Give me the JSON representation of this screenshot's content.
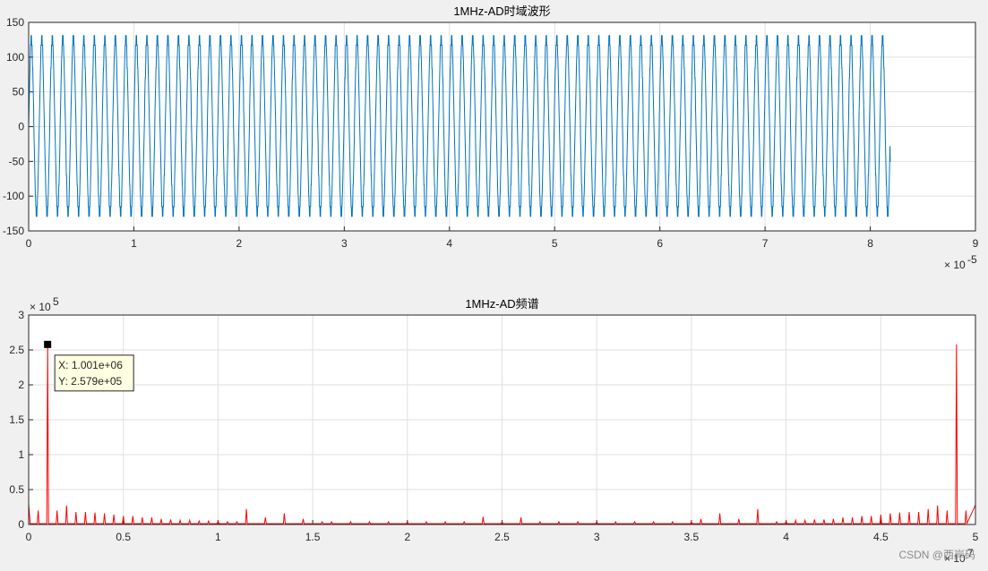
{
  "watermark": "CSDN @西岸码",
  "chart_data": [
    {
      "type": "line",
      "title": "1MHz-AD时域波形",
      "xlabel": "",
      "ylabel": "",
      "xlim": [
        0,
        9
      ],
      "ylim": [
        -150,
        150
      ],
      "x_exponent_label": "× 10",
      "x_exponent": "-5",
      "x_ticks": [
        "0",
        "1",
        "2",
        "3",
        "4",
        "5",
        "6",
        "7",
        "8",
        "9"
      ],
      "y_ticks": [
        "-150",
        "-100",
        "-50",
        "0",
        "50",
        "100",
        "150"
      ],
      "grid": true,
      "line_color": "#0072bd",
      "series": [
        {
          "signal_description": "sinusoid ~1 MHz, amplitude ≈ 122, sampled with visible quantization steps",
          "frequency_per_unit": 10.01,
          "amplitude": 122,
          "x_start": 0,
          "x_end": 8.19,
          "end_value": -50
        }
      ]
    },
    {
      "type": "line",
      "title": "1MHz-AD频谱",
      "xlabel": "",
      "ylabel": "",
      "xlim": [
        0,
        5
      ],
      "ylim": [
        0,
        3
      ],
      "x_exponent_label": "× 10",
      "x_exponent": "7",
      "y_exponent_label": "× 10",
      "y_exponent": "5",
      "x_ticks": [
        "0",
        "0.5",
        "1",
        "1.5",
        "2",
        "2.5",
        "3",
        "3.5",
        "4",
        "4.5",
        "5"
      ],
      "y_ticks": [
        "0",
        "0.5",
        "1",
        "1.5",
        "2",
        "2.5",
        "3"
      ],
      "grid": true,
      "line_color": "#ff0000",
      "peaks": [
        {
          "x": 0.1001,
          "y": 2.579
        },
        {
          "x": 4.8999,
          "y": 2.579
        }
      ],
      "minor_peaks": [
        {
          "x": 0.05,
          "y": 0.2
        },
        {
          "x": 0.15,
          "y": 0.2
        },
        {
          "x": 0.2,
          "y": 0.27
        },
        {
          "x": 0.25,
          "y": 0.18
        },
        {
          "x": 0.3,
          "y": 0.18
        },
        {
          "x": 0.35,
          "y": 0.17
        },
        {
          "x": 0.4,
          "y": 0.16
        },
        {
          "x": 0.45,
          "y": 0.14
        },
        {
          "x": 0.5,
          "y": 0.12
        },
        {
          "x": 0.55,
          "y": 0.12
        },
        {
          "x": 0.6,
          "y": 0.1
        },
        {
          "x": 0.65,
          "y": 0.1
        },
        {
          "x": 0.7,
          "y": 0.08
        },
        {
          "x": 0.75,
          "y": 0.07
        },
        {
          "x": 0.8,
          "y": 0.06
        },
        {
          "x": 0.85,
          "y": 0.06
        },
        {
          "x": 0.9,
          "y": 0.05
        },
        {
          "x": 0.95,
          "y": 0.05
        },
        {
          "x": 1.0,
          "y": 0.05
        },
        {
          "x": 1.05,
          "y": 0.04
        },
        {
          "x": 1.1,
          "y": 0.04
        },
        {
          "x": 1.15,
          "y": 0.22
        },
        {
          "x": 1.25,
          "y": 0.1
        },
        {
          "x": 1.35,
          "y": 0.16
        },
        {
          "x": 1.45,
          "y": 0.08
        },
        {
          "x": 1.55,
          "y": 0.04
        },
        {
          "x": 1.6,
          "y": 0.04
        },
        {
          "x": 1.7,
          "y": 0.04
        },
        {
          "x": 1.8,
          "y": 0.04
        },
        {
          "x": 1.9,
          "y": 0.04
        },
        {
          "x": 2.0,
          "y": 0.04
        },
        {
          "x": 2.1,
          "y": 0.04
        },
        {
          "x": 2.2,
          "y": 0.04
        },
        {
          "x": 2.3,
          "y": 0.04
        },
        {
          "x": 2.4,
          "y": 0.11
        },
        {
          "x": 2.5,
          "y": 0.04
        },
        {
          "x": 2.6,
          "y": 0.1
        },
        {
          "x": 2.7,
          "y": 0.04
        },
        {
          "x": 2.8,
          "y": 0.04
        },
        {
          "x": 2.9,
          "y": 0.04
        },
        {
          "x": 3.0,
          "y": 0.04
        },
        {
          "x": 3.1,
          "y": 0.04
        },
        {
          "x": 3.2,
          "y": 0.04
        },
        {
          "x": 3.3,
          "y": 0.04
        },
        {
          "x": 3.4,
          "y": 0.04
        },
        {
          "x": 3.5,
          "y": 0.04
        },
        {
          "x": 3.55,
          "y": 0.08
        },
        {
          "x": 3.65,
          "y": 0.16
        },
        {
          "x": 3.75,
          "y": 0.08
        },
        {
          "x": 3.85,
          "y": 0.22
        },
        {
          "x": 3.95,
          "y": 0.04
        },
        {
          "x": 4.0,
          "y": 0.05
        },
        {
          "x": 4.05,
          "y": 0.06
        },
        {
          "x": 4.1,
          "y": 0.06
        },
        {
          "x": 4.15,
          "y": 0.07
        },
        {
          "x": 4.2,
          "y": 0.07
        },
        {
          "x": 4.25,
          "y": 0.08
        },
        {
          "x": 4.3,
          "y": 0.1
        },
        {
          "x": 4.35,
          "y": 0.1
        },
        {
          "x": 4.4,
          "y": 0.12
        },
        {
          "x": 4.45,
          "y": 0.12
        },
        {
          "x": 4.5,
          "y": 0.14
        },
        {
          "x": 4.55,
          "y": 0.16
        },
        {
          "x": 4.6,
          "y": 0.17
        },
        {
          "x": 4.65,
          "y": 0.18
        },
        {
          "x": 4.7,
          "y": 0.18
        },
        {
          "x": 4.75,
          "y": 0.22
        },
        {
          "x": 4.8,
          "y": 0.27
        },
        {
          "x": 4.85,
          "y": 0.2
        },
        {
          "x": 4.95,
          "y": 0.2
        }
      ],
      "datatip": {
        "x": 0.1001,
        "y": 2.579,
        "x_text": "X: 1.001e+06",
        "y_text": "Y: 2.579e+05"
      }
    }
  ]
}
